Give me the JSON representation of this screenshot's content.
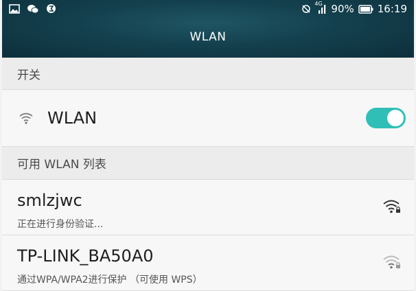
{
  "status_bar": {
    "left_icons": [
      "image-icon",
      "wechat-icon",
      "notification-icon"
    ],
    "network_type": "4G",
    "battery_percent": "90%",
    "time": "16:19"
  },
  "header": {
    "title": "WLAN"
  },
  "switch_section": {
    "header": "开关",
    "wlan_label": "WLAN",
    "wlan_enabled": true
  },
  "networks_section": {
    "header": "可用 WLAN 列表",
    "networks": [
      {
        "ssid": "smlzjwc",
        "status": "正在进行身份验证...",
        "secured": true,
        "signal": 1.0
      },
      {
        "ssid": "TP-LINK_BA50A0",
        "status": "通过WPA/WPA2进行保护 （可使用 WPS）",
        "secured": true,
        "signal": 0.5
      }
    ]
  },
  "colors": {
    "header_bg": "#14404e",
    "toggle_on": "#2fbfb7",
    "section_bg": "#ececec",
    "row_bg": "#f7f7f7"
  }
}
